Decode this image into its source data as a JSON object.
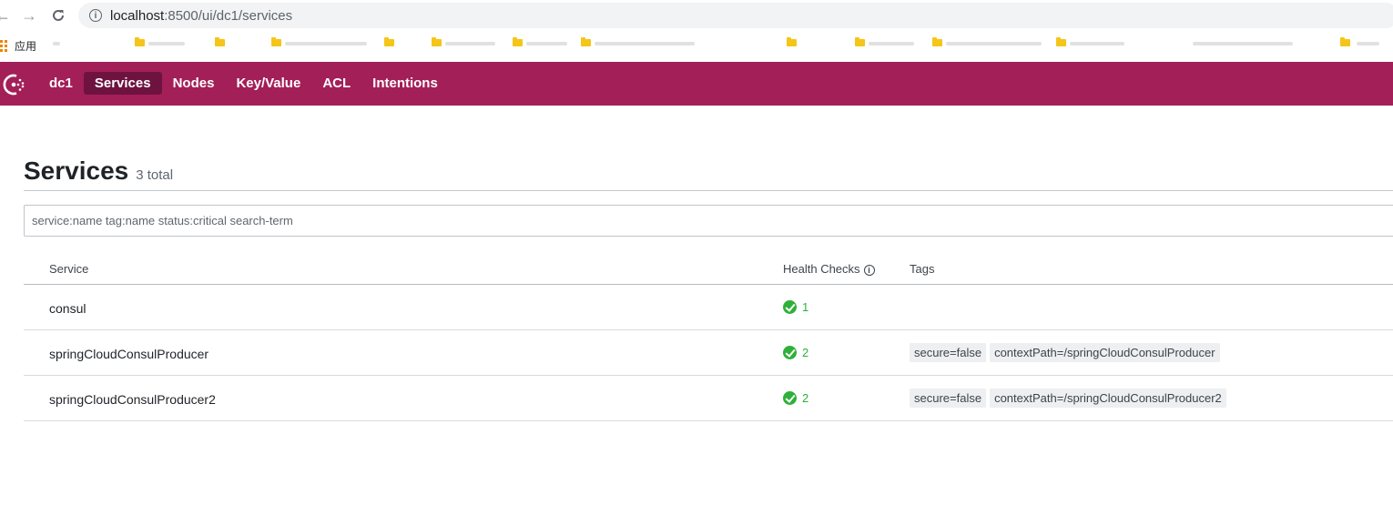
{
  "browser": {
    "url_host": "localhost",
    "url_path": ":8500/ui/dc1/services",
    "bookmarks_apps_label": "应用"
  },
  "header": {
    "datacenter": "dc1",
    "nav": [
      {
        "label": "Services",
        "active": true
      },
      {
        "label": "Nodes",
        "active": false
      },
      {
        "label": "Key/Value",
        "active": false
      },
      {
        "label": "ACL",
        "active": false
      },
      {
        "label": "Intentions",
        "active": false
      }
    ],
    "brand_color": "#a31f58"
  },
  "main": {
    "title": "Services",
    "count": "3 total",
    "search_placeholder": "service:name tag:name status:critical search-term",
    "columns": {
      "service": "Service",
      "health": "Health Checks",
      "tags": "Tags"
    },
    "rows": [
      {
        "name": "consul",
        "health": "1",
        "tags": []
      },
      {
        "name": "springCloudConsulProducer",
        "health": "2",
        "tags": [
          "secure=false",
          "contextPath=/springCloudConsulProducer"
        ]
      },
      {
        "name": "springCloudConsulProducer2",
        "health": "2",
        "tags": [
          "secure=false",
          "contextPath=/springCloudConsulProducer2"
        ]
      }
    ]
  },
  "colors": {
    "passing": "#2eb039",
    "active_nav": "#6e1340"
  }
}
